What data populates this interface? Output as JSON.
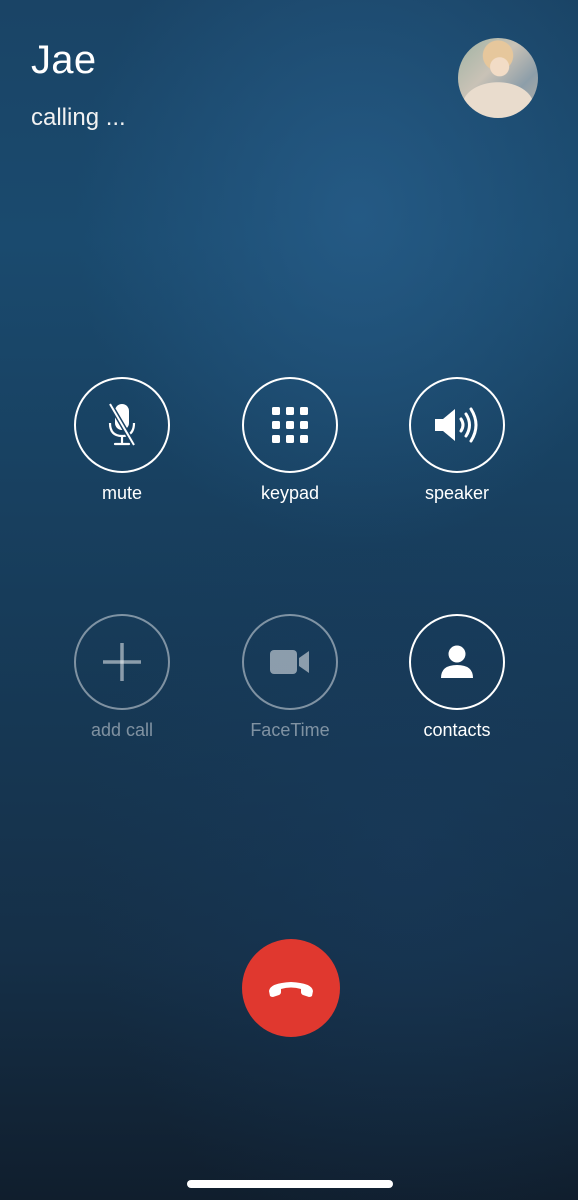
{
  "call": {
    "caller_name": "Jae",
    "status": "calling ..."
  },
  "controls": {
    "mute": {
      "label": "mute",
      "icon": "microphone-slash-icon",
      "enabled": true
    },
    "keypad": {
      "label": "keypad",
      "icon": "keypad-grid-icon",
      "enabled": true
    },
    "speaker": {
      "label": "speaker",
      "icon": "speaker-icon",
      "enabled": true
    },
    "add_call": {
      "label": "add call",
      "icon": "plus-icon",
      "enabled": false
    },
    "facetime": {
      "label": "FaceTime",
      "icon": "video-camera-icon",
      "enabled": false
    },
    "contacts": {
      "label": "contacts",
      "icon": "person-icon",
      "enabled": true
    }
  },
  "end_call": {
    "icon": "phone-hangup-icon",
    "color": "#e0382f"
  },
  "colors": {
    "background_top": "#1a4466",
    "background_bottom": "#101e2d",
    "end_call_red": "#e0382f",
    "disabled_white": "rgba(255,255,255,0.45)"
  }
}
